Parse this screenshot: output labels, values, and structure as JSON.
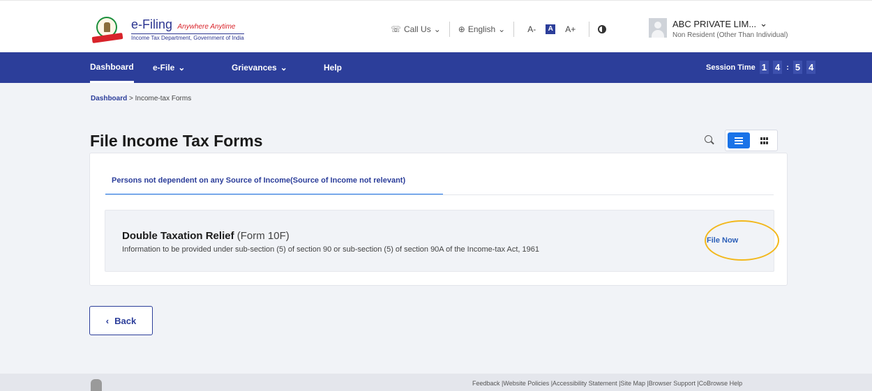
{
  "header": {
    "logo_title": "e-Filing",
    "logo_tagline": "Anywhere Anytime",
    "logo_subtitle": "Income Tax Department, Government of India",
    "call_us": "Call Us",
    "language": "English",
    "font_decrease": "A-",
    "font_normal": "A",
    "font_increase": "A+",
    "user_name": "ABC PRIVATE LIM...",
    "user_type": "Non Resident (Other Than Individual)"
  },
  "nav": {
    "items": [
      {
        "label": "Dashboard"
      },
      {
        "label": "e-File"
      },
      {
        "label": "Grievances"
      },
      {
        "label": "Help"
      }
    ],
    "session_label": "Session Time",
    "session_digits": [
      "1",
      "4",
      ":",
      "5",
      "4"
    ]
  },
  "breadcrumb": {
    "home": "Dashboard",
    "separator": ">",
    "current": "Income-tax Forms"
  },
  "page": {
    "title": "File Income Tax Forms",
    "tab_label": "Persons not dependent on any Source of Income(Source of Income not relevant)",
    "form": {
      "name": "Double Taxation Relief",
      "code": "(Form 10F)",
      "description": "Information to be provided under sub-section (5) of section 90 or sub-section (5) of section 90A of the Income-tax Act, 1961",
      "action_label": "File Now"
    },
    "back_label": "Back"
  },
  "footer": {
    "links": "Feedback |Website Policies |Accessibility Statement |Site Map |Browser Support |CoBrowse Help"
  },
  "colors": {
    "nav_bg": "#2c3e9a",
    "accent_blue": "#1a73e8",
    "highlight_ring": "#f2b81c"
  }
}
